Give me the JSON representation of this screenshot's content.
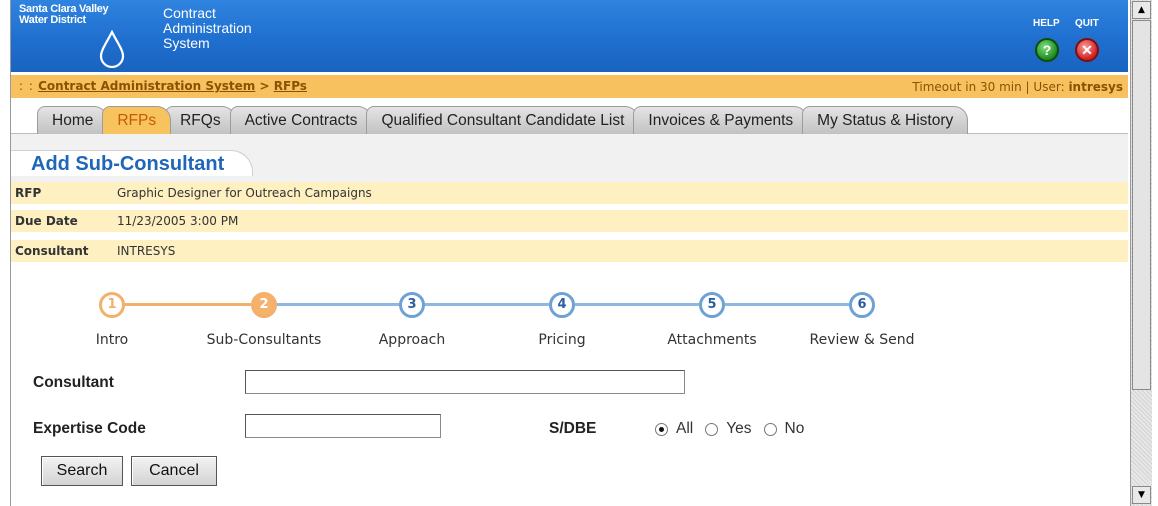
{
  "header": {
    "org_line1": "Santa Clara Valley",
    "org_line2": "Water District",
    "app_line1": "Contract",
    "app_line2": "Administration",
    "app_line3": "System",
    "help_label": "HELP",
    "quit_label": "QUIT",
    "help_glyph": "?",
    "quit_glyph": "✕",
    "colors": {
      "header_blue": "#1f6fcf",
      "bar_orange": "#f8c15f"
    }
  },
  "breadcrumb": {
    "prefix": ": :",
    "root": "Contract Administration System",
    "separator": ">",
    "current": "RFPs"
  },
  "session": {
    "timeout": "Timeout in 30 min",
    "divider": "|",
    "user_prefix": "User:",
    "user": "intresys"
  },
  "tabs": [
    {
      "label": "Home",
      "active": false
    },
    {
      "label": "RFPs",
      "active": true
    },
    {
      "label": "RFQs",
      "active": false
    },
    {
      "label": "Active Contracts",
      "active": false
    },
    {
      "label": "Qualified Consultant Candidate List",
      "active": false
    },
    {
      "label": "Invoices & Payments",
      "active": false
    },
    {
      "label": "My Status & History",
      "active": false
    }
  ],
  "page": {
    "title": "Add Sub-Consultant"
  },
  "info": {
    "rfp_label": "RFP",
    "rfp_value": "Graphic Designer for Outreach Campaigns",
    "due_label": "Due Date",
    "due_value": "11/23/2005 3:00 PM",
    "consultant_label": "Consultant",
    "consultant_value": "INTRESYS"
  },
  "steps": [
    {
      "num": "1",
      "label": "Intro",
      "state": "done"
    },
    {
      "num": "2",
      "label": "Sub-Consultants",
      "state": "current"
    },
    {
      "num": "3",
      "label": "Approach",
      "state": "todo"
    },
    {
      "num": "4",
      "label": "Pricing",
      "state": "todo"
    },
    {
      "num": "5",
      "label": "Attachments",
      "state": "todo"
    },
    {
      "num": "6",
      "label": "Review & Send",
      "state": "todo"
    }
  ],
  "form": {
    "consultant_label": "Consultant",
    "consultant_value": "",
    "expertise_label": "Expertise Code",
    "expertise_value": "",
    "sdbe_label": "S/DBE",
    "sdbe_options": [
      "All",
      "Yes",
      "No"
    ],
    "sdbe_selected": "All",
    "search_button": "Search",
    "cancel_button": "Cancel"
  },
  "scrollbar": {
    "up": "▲",
    "down": "▼"
  }
}
